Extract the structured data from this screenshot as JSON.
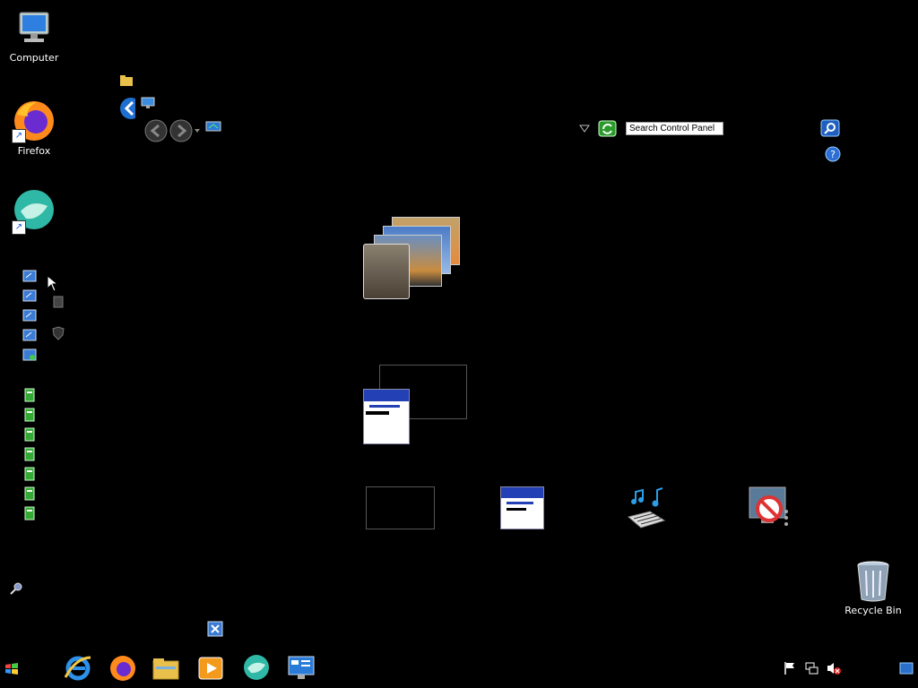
{
  "desktop": {
    "icons": {
      "computer": "Computer",
      "firefox": "Firefox",
      "recycle_bin": "Recycle Bin"
    }
  },
  "control_panel": {
    "search_text": "Search Control Panel"
  },
  "colors": {
    "background": "#000000",
    "accent_blue": "#2341b5"
  },
  "taskbar": {
    "apps": [
      "internet-explorer-icon",
      "firefox-icon",
      "file-explorer-icon",
      "media-player-icon",
      "bird-app-icon",
      "control-panel-icon"
    ]
  }
}
